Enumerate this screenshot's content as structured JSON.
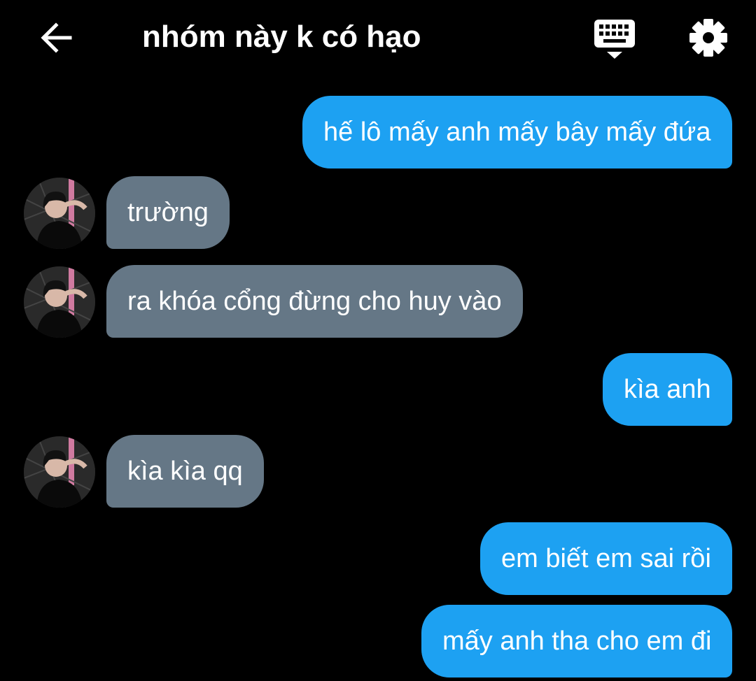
{
  "header": {
    "title": "nhóm này k có hạo",
    "back_icon": "arrow-left-icon",
    "keyboard_icon": "keyboard-icon",
    "settings_icon": "gear-icon"
  },
  "colors": {
    "background": "#000000",
    "outgoing_bubble": "#1DA1F2",
    "incoming_bubble": "#657786",
    "text": "#ffffff"
  },
  "messages": [
    {
      "direction": "outgoing",
      "text": "hế lô mấy anh mấy bây mấy đứa"
    },
    {
      "direction": "incoming",
      "text": "trường",
      "avatar": "user-avatar"
    },
    {
      "direction": "incoming",
      "text": "ra khóa cổng đừng cho huy vào",
      "avatar": "user-avatar"
    },
    {
      "direction": "outgoing",
      "text": "kìa anh"
    },
    {
      "direction": "incoming",
      "text": "kìa kìa qq",
      "avatar": "user-avatar"
    },
    {
      "direction": "outgoing",
      "text": "em biết em sai rồi"
    },
    {
      "direction": "outgoing",
      "text": "mấy anh tha cho em đi"
    }
  ]
}
